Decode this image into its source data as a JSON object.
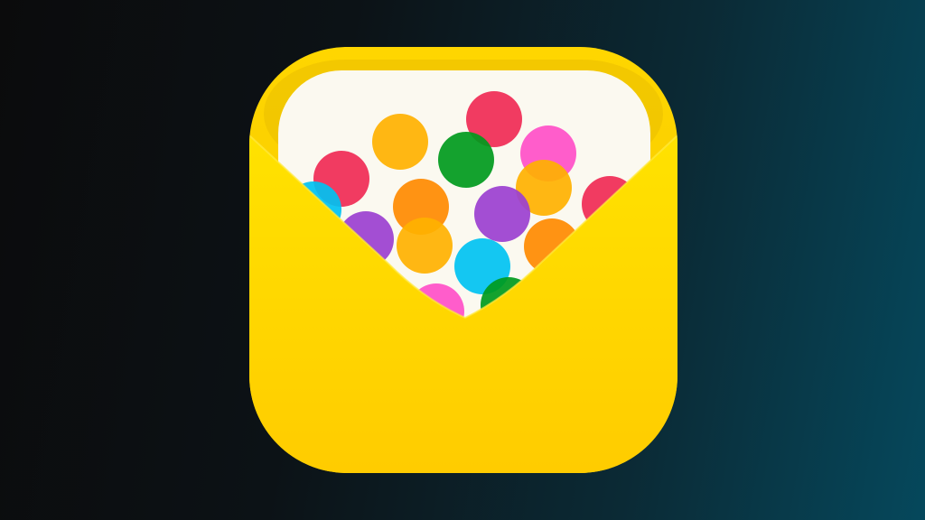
{
  "app_icon": {
    "icon": "envelope-with-confetti-icon",
    "colors": {
      "background_dark": "#0b0b0c",
      "background_teal": "#05485c",
      "envelope_top": "#f5d000",
      "envelope_bottom": "#ffd400",
      "paper": "#fbf9f0"
    },
    "confetti_colors": [
      "#f02a55",
      "#ffb100",
      "#00c2f2",
      "#009a1d",
      "#ff4fc8",
      "#ff8a00",
      "#9b3fd0"
    ]
  }
}
